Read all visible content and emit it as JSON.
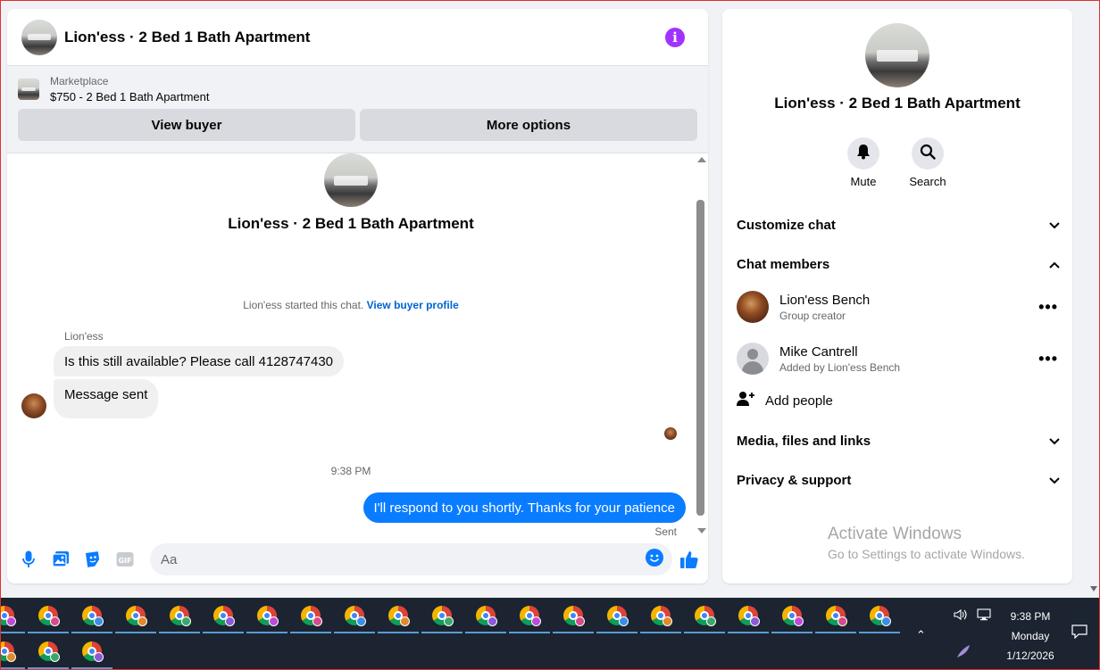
{
  "chat": {
    "title": "Lion'ess · 2 Bed 1 Bath Apartment",
    "marketplace_label": "Marketplace",
    "listing": "$750 - 2 Bed 1 Bath Apartment",
    "view_buyer": "View buyer",
    "more_options": "More options",
    "intro_title": "Lion'ess · 2 Bed 1 Bath Apartment",
    "started_text": "Lion'ess started this chat.",
    "view_buyer_profile": "View buyer profile",
    "sender_name": "Lion'ess",
    "messages_in": [
      "Is this still available? Please call 4128747430",
      "Message sent"
    ],
    "timestamp": "9:38 PM",
    "message_out": "I'll respond to you shortly. Thanks for your patience",
    "sent_status": "Sent",
    "composer_placeholder": "Aa"
  },
  "info": {
    "title": "Lion'ess · 2 Bed 1 Bath Apartment",
    "mute": "Mute",
    "search": "Search",
    "customize_chat": "Customize chat",
    "chat_members": "Chat members",
    "members": [
      {
        "name": "Lion'ess Bench",
        "sub": "Group creator"
      },
      {
        "name": "Mike Cantrell",
        "sub": "Added by Lion'ess Bench"
      }
    ],
    "add_people": "Add people",
    "media": "Media, files and links",
    "privacy": "Privacy & support",
    "activate_title": "Activate Windows",
    "activate_sub": "Go to Settings to activate Windows."
  },
  "taskbar": {
    "time": "9:38 PM",
    "day": "Monday",
    "date": "1/12/2026",
    "app_icon": "chrome-icon",
    "badge_colors": [
      "#c04ad8",
      "#d84a8a",
      "#3a8ee6",
      "#e08a2a",
      "#3aa76d",
      "#8a5ad8"
    ]
  },
  "colors": {
    "accent_blue": "#0a7cff",
    "info_purple": "#a033ff",
    "taskbar_bg": "#1b2430"
  }
}
